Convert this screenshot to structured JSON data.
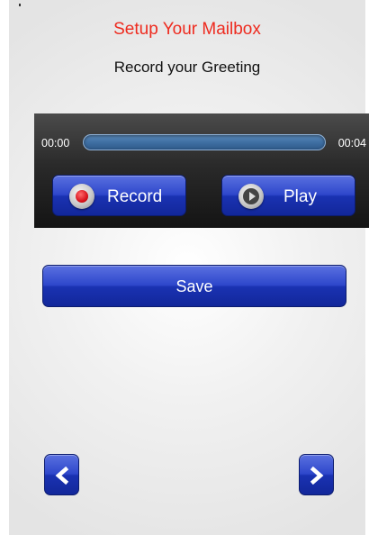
{
  "header": {
    "title": "Setup Your Mailbox",
    "subtitle": "Record your Greeting"
  },
  "player": {
    "start_time": "00:00",
    "end_time": "00:04",
    "progress": 0,
    "record_label": "Record",
    "play_label": "Play"
  },
  "actions": {
    "save_label": "Save"
  },
  "navigation": {
    "prev_icon": "chevron-left-icon",
    "next_icon": "chevron-right-icon"
  },
  "colors": {
    "title": "#ee2b1f",
    "button_blue": "#2e47cb",
    "panel": "#2a2a2a",
    "record_red": "#d8141d"
  }
}
